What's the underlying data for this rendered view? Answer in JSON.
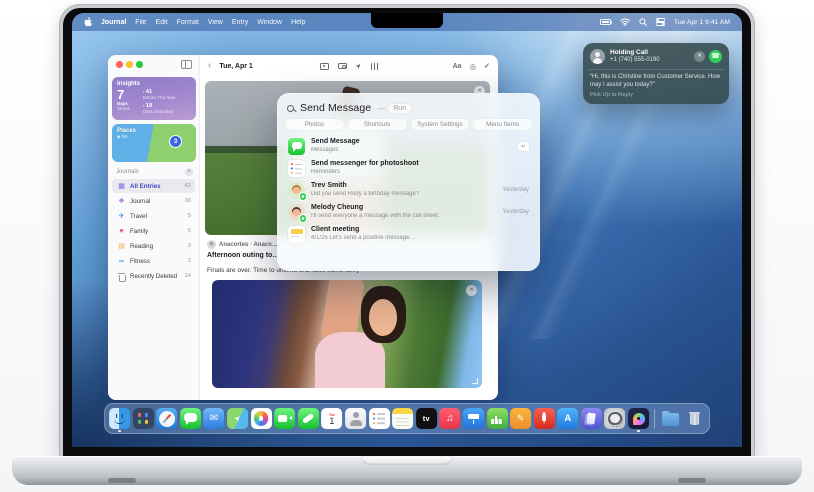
{
  "menu_bar": {
    "app_name": "Journal",
    "menus": [
      "File",
      "Edit",
      "Format",
      "View",
      "Entry",
      "Window",
      "Help"
    ],
    "clock": "Tue Apr 1  9:41 AM"
  },
  "notification": {
    "title": "Holding Call",
    "number": "+1 (740) 555-0190",
    "message": "“Hi, this is Christine from Customer Service. How may I assist you today?”",
    "action": "Pick Up to Reply"
  },
  "window": {
    "sidebar": {
      "insights": {
        "title": "Insights",
        "streak_value": "7",
        "streak_unit": "Days",
        "streak_label": "Streak",
        "entries_value": "41",
        "entries_label": "Entries This Year",
        "days_value": "19",
        "days_label": "Days Journaled"
      },
      "places": {
        "title": "Places",
        "count": "59",
        "badge": "3"
      },
      "journals_header": "Journals",
      "journals": [
        {
          "label": "All Entries",
          "count": "42",
          "icon": "grid"
        },
        {
          "label": "Journal",
          "count": "36",
          "icon": "journal"
        },
        {
          "label": "Travel",
          "count": "5",
          "icon": "travel"
        },
        {
          "label": "Family",
          "count": "5",
          "icon": "family"
        },
        {
          "label": "Reading",
          "count": "3",
          "icon": "reading"
        },
        {
          "label": "Fitness",
          "count": "2",
          "icon": "fitness"
        },
        {
          "label": "Recently Deleted",
          "count": "14",
          "icon": "deleted"
        }
      ]
    },
    "toolbar": {
      "back_glyph": "‹",
      "title": "Tue, Apr 1",
      "format_label": "Aa",
      "list_glyph": "◎",
      "done_glyph": "✓"
    },
    "entry": {
      "location": "Anacortes · Anaco…",
      "title": "Afternoon outing to…",
      "body": "Finals are over. Time to unwind and have some fun!"
    }
  },
  "search": {
    "query": "Send Message",
    "hint_dash": "—",
    "hint_key": "Run",
    "chips": [
      "Photos",
      "Shortcuts",
      "System Settings",
      "Menu Items"
    ],
    "results": [
      {
        "title": "Send Message",
        "subtitle": "Messages",
        "meta": "↵",
        "kind": "messages"
      },
      {
        "title": "Send messenger for photoshoot",
        "subtitle": "Reminders",
        "meta": "",
        "kind": "reminders"
      },
      {
        "title": "Trev Smith",
        "subtitle": "Did you send Rody a birthday message?",
        "meta": "Yesterday",
        "kind": "contact-trev"
      },
      {
        "title": "Melody Cheung",
        "subtitle": "I'll send everyone a message with the call sheet.",
        "meta": "Yesterday",
        "kind": "contact-melody"
      },
      {
        "title": "Client meeting",
        "subtitle": "4/1/25 Let's send a positive message…",
        "meta": "",
        "kind": "event"
      }
    ]
  },
  "dock": {
    "apps": [
      "finder",
      "launchpad",
      "safari",
      "messages",
      "mail",
      "maps",
      "photos",
      "facetime",
      "phone",
      "calendar",
      "contacts",
      "reminders",
      "notes",
      "tv",
      "music",
      "keynote",
      "numbers",
      "pages",
      "rocket",
      "app-store",
      "books",
      "system-settings",
      "journal"
    ],
    "extras": [
      "downloads",
      "trash"
    ],
    "running": [
      "finder",
      "journal"
    ],
    "calendar": {
      "weekday": "Tue",
      "day": "1"
    }
  },
  "icons": {
    "close_glyph": "✕",
    "phone_glyph": "☎",
    "plus_glyph": "+"
  },
  "colors": {
    "menu_bar_blue": "#4068a8",
    "wallpaper_deep": "#1f4177",
    "accent_blue": "#3478f6",
    "answer_green": "#30d158",
    "messages_green": "#16c02f",
    "insights_purple": "#8f7bc7"
  }
}
